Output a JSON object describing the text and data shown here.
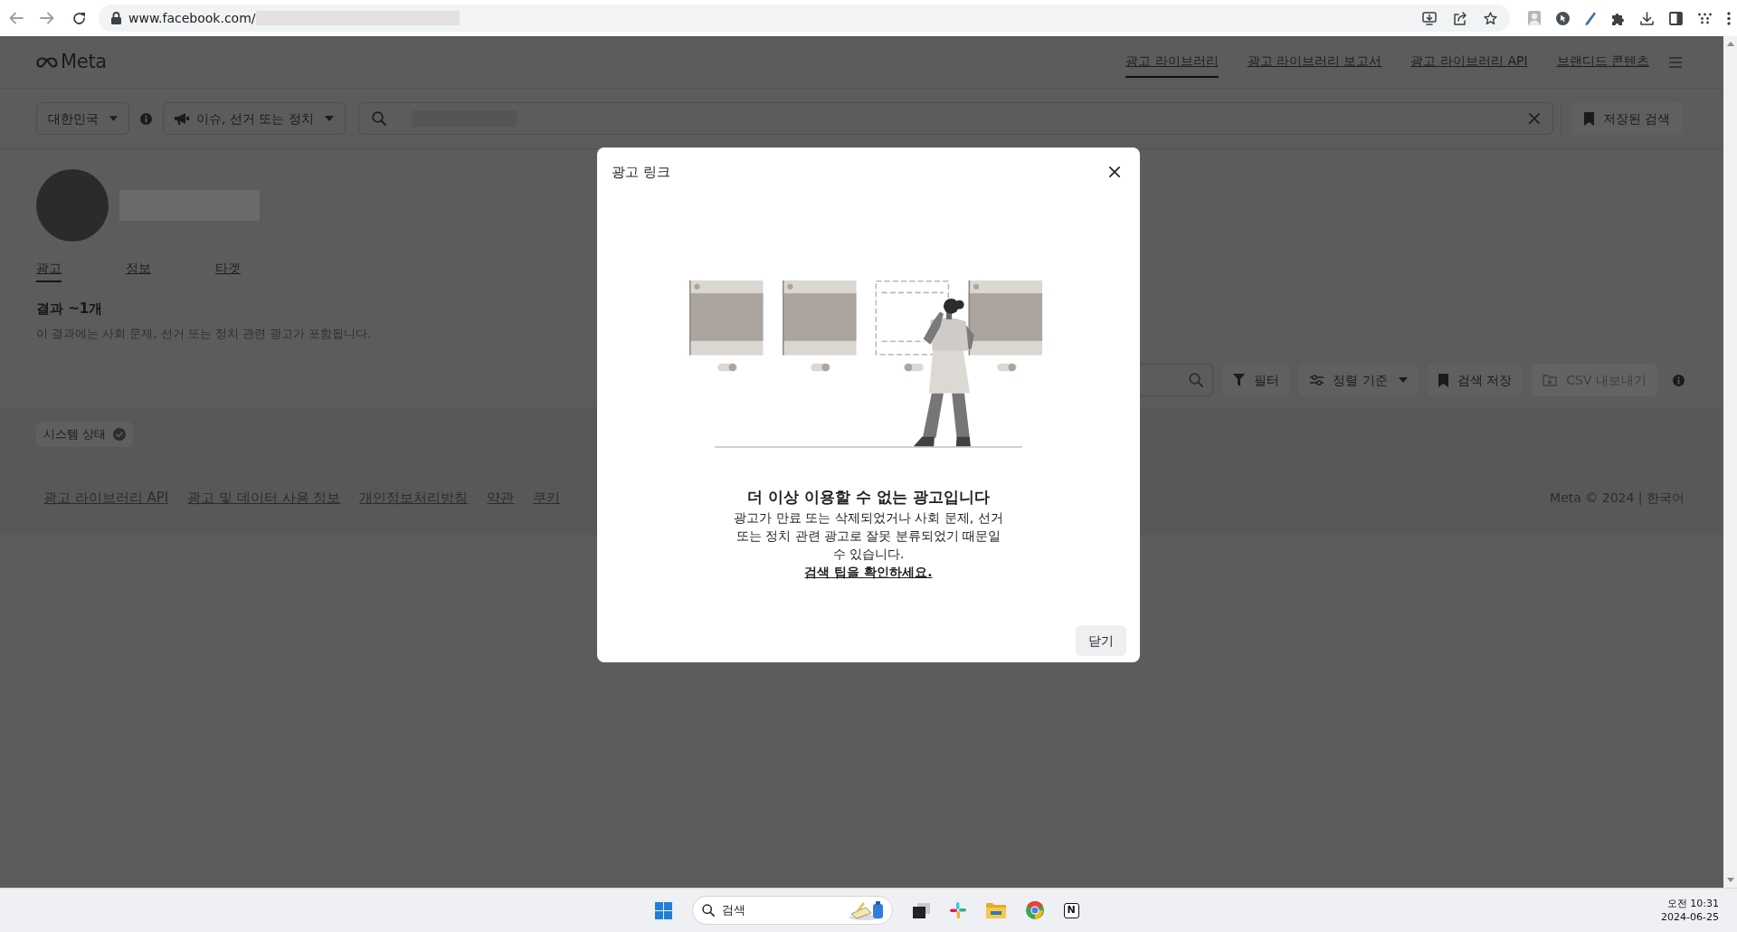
{
  "browser": {
    "url": "www.facebook.com/"
  },
  "header": {
    "logo": "Meta",
    "nav": [
      {
        "label": "광고 라이브러리",
        "selected": true
      },
      {
        "label": "광고 라이브러리 보고서",
        "selected": false
      },
      {
        "label": "광고 라이브러리 API",
        "selected": false
      },
      {
        "label": "브랜디드 콘텐츠",
        "selected": false
      }
    ]
  },
  "search_bar": {
    "country": "대한민국",
    "category": "이슈, 선거 또는 정치",
    "saved_searches": "저장된 검색"
  },
  "profile": {
    "tabs": [
      {
        "label": "광고",
        "selected": true
      },
      {
        "label": "정보",
        "selected": false
      },
      {
        "label": "타겟",
        "selected": false
      }
    ],
    "results_title": "결과 ~1개",
    "results_note": "이 결과에는 사회 문제, 선거 또는 정치 관련 광고가 포함됩니다."
  },
  "toolbar": {
    "buttons": [
      {
        "label": "필터",
        "kind": "filter",
        "disabled": false
      },
      {
        "label": "정렬 기준",
        "kind": "sort",
        "disabled": false
      },
      {
        "label": "검색 저장",
        "kind": "save",
        "disabled": false
      },
      {
        "label": "CSV 내보내기",
        "kind": "export",
        "disabled": true
      }
    ]
  },
  "footer": {
    "status": "시스템 상태",
    "links": [
      "광고 라이브러리 API",
      "광고 및 데이터 사용 정보",
      "개인정보처리방침",
      "약관",
      "쿠키"
    ],
    "copyright": "Meta © 2024 | 한국어"
  },
  "modal": {
    "title": "광고 링크",
    "illustration_toggles": [
      {
        "on": true
      },
      {
        "on": true
      },
      {
        "on": false
      },
      {
        "on": true
      }
    ],
    "heading": "더 이상 이용할 수 없는 광고입니다",
    "body": "광고가 만료 또는 삭제되었거나 사회 문제, 선거 또는 정치 관련 광고로 잘못 분류되었기 때문일 수 있습니다.",
    "tip": "검색 팁을 확인하세요.",
    "close_button": "닫기"
  },
  "taskbar": {
    "search_placeholder": "검색",
    "app_tile": "N",
    "time": "오전 10:31",
    "date": "2024-06-25"
  }
}
